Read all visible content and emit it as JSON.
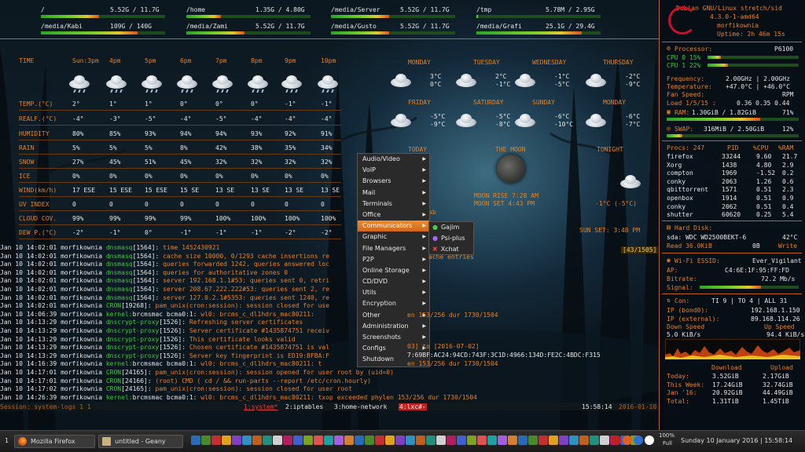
{
  "disks": [
    {
      "path": "/",
      "used": "5.52G",
      "total": "11.7G",
      "fill": 0.47
    },
    {
      "path": "/home",
      "used": "1.35G",
      "total": "4.80G",
      "fill": 0.28
    },
    {
      "path": "/media/Server",
      "used": "5.52G",
      "total": "11.7G",
      "fill": 0.47
    },
    {
      "path": "/tmp",
      "used": "5.78M",
      "total": "2.95G",
      "fill": 0.01
    },
    {
      "path": "/media/Kabi",
      "used": "109G",
      "total": "140G",
      "fill": 0.78
    },
    {
      "path": "/media/Zami",
      "used": "5.52G",
      "total": "11.7G",
      "fill": 0.47
    },
    {
      "path": "/media/Gusto",
      "used": "5.52G",
      "total": "11.7G",
      "fill": 0.47
    },
    {
      "path": "/media/Grafi",
      "used": "25.1G",
      "total": "29.4G",
      "fill": 0.85
    }
  ],
  "hourly": {
    "time_label": "TIME",
    "times": [
      "Sun:3pm",
      "4pm",
      "5pm",
      "6pm",
      "7pm",
      "8pm",
      "9pm",
      "10pm"
    ],
    "rows": [
      {
        "label": "TEMP.(°C)",
        "values": [
          "2°",
          "1°",
          "1°",
          "0°",
          "0°",
          "0°",
          "-1°",
          "-1°"
        ]
      },
      {
        "label": "REALF.(°C)",
        "values": [
          "-4°",
          "-3°",
          "-5°",
          "-4°",
          "-5°",
          "-4°",
          "-4°",
          "-4°"
        ]
      },
      {
        "label": "HUMIDITY",
        "values": [
          "80%",
          "85%",
          "93%",
          "94%",
          "94%",
          "93%",
          "92%",
          "91%"
        ]
      },
      {
        "label": "RAIN",
        "values": [
          "5%",
          "5%",
          "5%",
          "8%",
          "42%",
          "38%",
          "35%",
          "34%"
        ]
      },
      {
        "label": "SNOW",
        "values": [
          "27%",
          "45%",
          "51%",
          "45%",
          "32%",
          "32%",
          "32%",
          "32%"
        ]
      },
      {
        "label": "ICE",
        "values": [
          "0%",
          "0%",
          "0%",
          "0%",
          "0%",
          "0%",
          "0%",
          "0%"
        ]
      },
      {
        "label": "WIND(km/h)",
        "values": [
          "17 ESE",
          "15 ESE",
          "15 ESE",
          "15 SE",
          "13 SE",
          "13 SE",
          "13 SE",
          "13 SE"
        ]
      },
      {
        "label": "UV INDEX",
        "values": [
          "0",
          "0",
          "0",
          "0",
          "0",
          "0",
          "0",
          "0"
        ]
      },
      {
        "label": "CLOUD COV.",
        "values": [
          "99%",
          "99%",
          "99%",
          "99%",
          "100%",
          "100%",
          "100%",
          "100%"
        ]
      },
      {
        "label": "DEW P.(°C)",
        "values": [
          "-2°",
          "-1°",
          "0°",
          "-1°",
          "-1°",
          "-1°",
          "-2°",
          "-2°"
        ]
      }
    ]
  },
  "daily": [
    {
      "day": "MONDAY",
      "hi": "3°C",
      "lo": "0°C"
    },
    {
      "day": "TUESDAY",
      "hi": "2°C",
      "lo": "-1°C"
    },
    {
      "day": "WEDNESDAY",
      "hi": "-1°C",
      "lo": "-5°C"
    },
    {
      "day": "THURSDAY",
      "hi": "-2°C",
      "lo": "-9°C"
    },
    {
      "day": "FRIDAY",
      "hi": "-5°C",
      "lo": "-9°C"
    },
    {
      "day": "SATURDAY",
      "hi": "-5°C",
      "lo": "-8°C"
    },
    {
      "day": "SUNDAY",
      "hi": "-6°C",
      "lo": "-10°C"
    },
    {
      "day": "MONDAY",
      "hi": "-6°C",
      "lo": "-7°C"
    }
  ],
  "today": {
    "today_label": "TODAY",
    "moon_label": "THE MOON",
    "tonight_label": "TONIGHT",
    "moon_rise": "MOON RISE 7:28 AM",
    "moon_set": "MOON SET 4:43 PM",
    "tonight_temp": "-1°C (-5°C)",
    "sun_set": "SUN SET: 3:48 PM",
    "ab": "ab"
  },
  "log": {
    "counter": "[43/1505]",
    "lines": [
      {
        "date": "Jan 10 14:02:01",
        "host": "morfikownia",
        "proc": "dnsmasq",
        "pid": "[1564]:",
        "msg": "time 1452430921"
      },
      {
        "date": "Jan 10 14:02:01",
        "host": "morfikownia",
        "proc": "dnsmasq",
        "pid": "[1564]:",
        "msg": "cache size 10000, 0/1293 cache insertions re"
      },
      {
        "date": "Jan 10 14:02:01",
        "host": "morfikownia",
        "proc": "dnsmasq",
        "pid": "[1564]:",
        "msg": "queries forwarded 1242, queries answered loc"
      },
      {
        "date": "Jan 10 14:02:01",
        "host": "morfikownia",
        "proc": "dnsmasq",
        "pid": "[1564]:",
        "msg": "queries for authoritative zones 0"
      },
      {
        "date": "Jan 10 14:02:01",
        "host": "morfikownia",
        "proc": "dnsmasq",
        "pid": "[1564]:",
        "msg": "server 192.168.1.1#53: queries sent 0, retri"
      },
      {
        "date": "Jan 10 14:02:01",
        "host": "morfikownia",
        "proc": "dnsmasq",
        "pid": "[1564]:",
        "msg": "server 208.67.222.222#53: queries sent 2, re"
      },
      {
        "date": "Jan 10 14:02:01",
        "host": "morfikownia",
        "proc": "dnsmasq",
        "pid": "[1564]:",
        "msg": "server 127.0.2.1#5353: queries sent 1240, re"
      },
      {
        "date": "Jan 10 14:02:01",
        "host": "morfikownia",
        "proc": "CRON",
        "pid": "[19268]:",
        "msg": "pam_unix(cron:session): session closed for use"
      },
      {
        "date": "Jan 10 14:06:39",
        "host": "morfikownia",
        "proc": "kernel:",
        "pid": "brcmsmac bcma0:1:",
        "msg": "wl0: brcms_c_dl1hdrs_mac80211:"
      },
      {
        "date": "Jan 10 14:13:29",
        "host": "morfikownia",
        "proc": "dnscrypt-proxy",
        "pid": "[1526]:",
        "msg": "Refreshing server certificates"
      },
      {
        "date": "Jan 10 14:13:29",
        "host": "morfikownia",
        "proc": "dnscrypt-proxy",
        "pid": "[1526]:",
        "msg": "Server certificate #1435874751 receiv"
      },
      {
        "date": "Jan 10 14:13:29",
        "host": "morfikownia",
        "proc": "dnscrypt-proxy",
        "pid": "[1526]:",
        "msg": "This certificate looks valid"
      },
      {
        "date": "Jan 10 14:13:29",
        "host": "morfikownia",
        "proc": "dnscrypt-proxy",
        "pid": "[1526]:",
        "msg": "Chosen certificate #1435874751 is val"
      },
      {
        "date": "Jan 10 14:13:29",
        "host": "morfikownia",
        "proc": "dnscrypt-proxy",
        "pid": "[1526]:",
        "msg": "Server key fingerprint is ED19:BFBA:F"
      },
      {
        "date": "Jan 10 14:16:39",
        "host": "morfikownia",
        "proc": "kernel:",
        "pid": "brcmsmac bcma0:1:",
        "msg": "wl0: brcms_c_dl1hdrs_mac80211:  t"
      },
      {
        "date": "Jan 10 14:17:01",
        "host": "morfikownia",
        "proc": "CRON",
        "pid": "[24165]:",
        "msg": "pam_unix(cron:session): session opened for user root by (uid=0)"
      },
      {
        "date": "Jan 10 14:17:01",
        "host": "morfikownia",
        "proc": "CRON",
        "pid": "[24166]:",
        "msg": "(root) CMD (   cd / && run-parts --report /etc/cron.hourly)"
      },
      {
        "date": "Jan 10 14:17:02",
        "host": "morfikownia",
        "proc": "CRON",
        "pid": "[24165]:",
        "msg": "pam_unix(cron:session): session closed for user root"
      },
      {
        "date": "Jan 10 14:26:39",
        "host": "morfikownia",
        "proc": "kernel:",
        "pid": "brcmsmac bcma0:1:",
        "msg": "wl0: brcms_c_dl1hdrs_mac80211:  txop exceeded phylen 153/256 dur 1730/1504"
      }
    ],
    "tails": [
      "ache entries",
      "en 153/256 dur 1730/1504",
      "03] to [2016-07-02]",
      "7:69BF:AC24:94CD:743F:3C1D:4966:134D:FE2C:4BDC:F315",
      "en 153/256 dur 1730/1504"
    ]
  },
  "tmux": {
    "session": "Session: system-logs 1 1",
    "w1": "1:system*",
    "w2": "2:iptables",
    "w3": "3:home-network",
    "w4": "4:lxc#-",
    "time": "15:58:14",
    "date": "2016-01-10"
  },
  "sys": {
    "distro": "Debian GNU/Linux stretch/sid",
    "kernel": "4.3.0-1-amd64",
    "host": "morfikownia",
    "uptime": "Uptime: 2h 46m 15s"
  },
  "cpu": {
    "label": "Processor:",
    "model": "P6100",
    "cpu0": "CPU 0 15%",
    "cpu1": "CPU 1 22%",
    "cpu0_fill": 0.15,
    "cpu1_fill": 0.22,
    "freq_label": "Frequency:",
    "freq": "2.00GHz | 2.00GHz",
    "temp_label": "Temperature:",
    "temp": "+47.0°C | +46.0°C",
    "fan_label": "Fan Speed:",
    "fan": "RPM",
    "load_label": "Load 1/5/15 :",
    "load": "0.36 0.35 0.44"
  },
  "ram": {
    "label": "RAM:",
    "value": "1.30GiB / 1.82GiB",
    "pct": "71%",
    "fill": 0.71,
    "swap_label": "SWAP:",
    "swap": "316MiB / 2.50GiB",
    "swap_pct": "12%",
    "swap_fill": 0.12
  },
  "procs": {
    "header": [
      "Procs: 247",
      "PID",
      "%CPU",
      "%RAM"
    ],
    "rows": [
      [
        "firefox",
        "33244",
        "9.60",
        "21.7"
      ],
      [
        "Xorg",
        "1438",
        "4.80",
        "2.9"
      ],
      [
        "compton",
        "1969",
        "-1.52",
        "0.2"
      ],
      [
        "conky",
        "2063",
        "1.26",
        "0.6"
      ],
      [
        "qbittorrent",
        "1571",
        "0.51",
        "2.3"
      ],
      [
        "openbox",
        "1914",
        "0.51",
        "0.9"
      ],
      [
        "conky",
        "2062",
        "0.51",
        "0.4"
      ],
      [
        "shutter",
        "60620",
        "0.25",
        "5.4"
      ]
    ]
  },
  "hdd": {
    "label": "Hard Disk:",
    "model": "sda: WDC WD2500BEKT-6",
    "temp": "42°C",
    "read": "Read  36.0KiB",
    "zero": "0B",
    "write": "Write"
  },
  "wifi": {
    "label": "Wi-Fi ESSID:",
    "essid": "Ever_Vigilant",
    "ap_label": "AP:",
    "ap": "C4:6E:1F:95:FF:FD",
    "bitrate_label": "Bitrate:",
    "bitrate": "72.2 Mb/s",
    "signal_label": "Signal:",
    "signal_fill": 0.62
  },
  "net": {
    "label": "Con:",
    "counts": "TI 9 | TO 4 | ALL 31",
    "ip_label": "IP (bond0):",
    "ip": "192.168.1.150",
    "ext_label": "IP (external):",
    "ext": "89.168.114.26",
    "down_label": "Down Speed",
    "up_label": "Up Speed",
    "down": "5.0 KiB/s",
    "up": "94.4 KiB/s"
  },
  "traffic": {
    "h_down": "Download",
    "h_up": "Upload",
    "rows": [
      [
        "Today:",
        "3.52GiB",
        "2.17GiB"
      ],
      [
        "This Week:",
        "17.24GiB",
        "32.74GiB"
      ],
      [
        "Jan '16:",
        "20.92GiB",
        "44.49GiB"
      ],
      [
        "Total:",
        "1.31TiB",
        "1.45TiB"
      ]
    ]
  },
  "menu": {
    "items": [
      "Audio/Video",
      "VoIP",
      "Browsers",
      "Mail",
      "Terminals",
      "Office",
      "Communicators",
      "Graphic",
      "File Managers",
      "P2P",
      "Online Storage",
      "CD/DVD",
      "Utils",
      "Encryption",
      "Other",
      "Administration",
      "Screenshots",
      "Configs",
      "Shutdown"
    ],
    "submenu": [
      "Gajim",
      "Psi-plus",
      "Xchat"
    ]
  },
  "taskbar": {
    "desktop": "1",
    "firefox": "Mozilla Firefox",
    "geany": "untitled - Geany",
    "battery": "100%",
    "battery_state": "Full",
    "clock": "Sunday 10 January 2016 | 15:58:14"
  },
  "colors": {
    "accent": "#e8821e",
    "menu_active": "#e07820",
    "bar_green": "#3cc83c"
  }
}
